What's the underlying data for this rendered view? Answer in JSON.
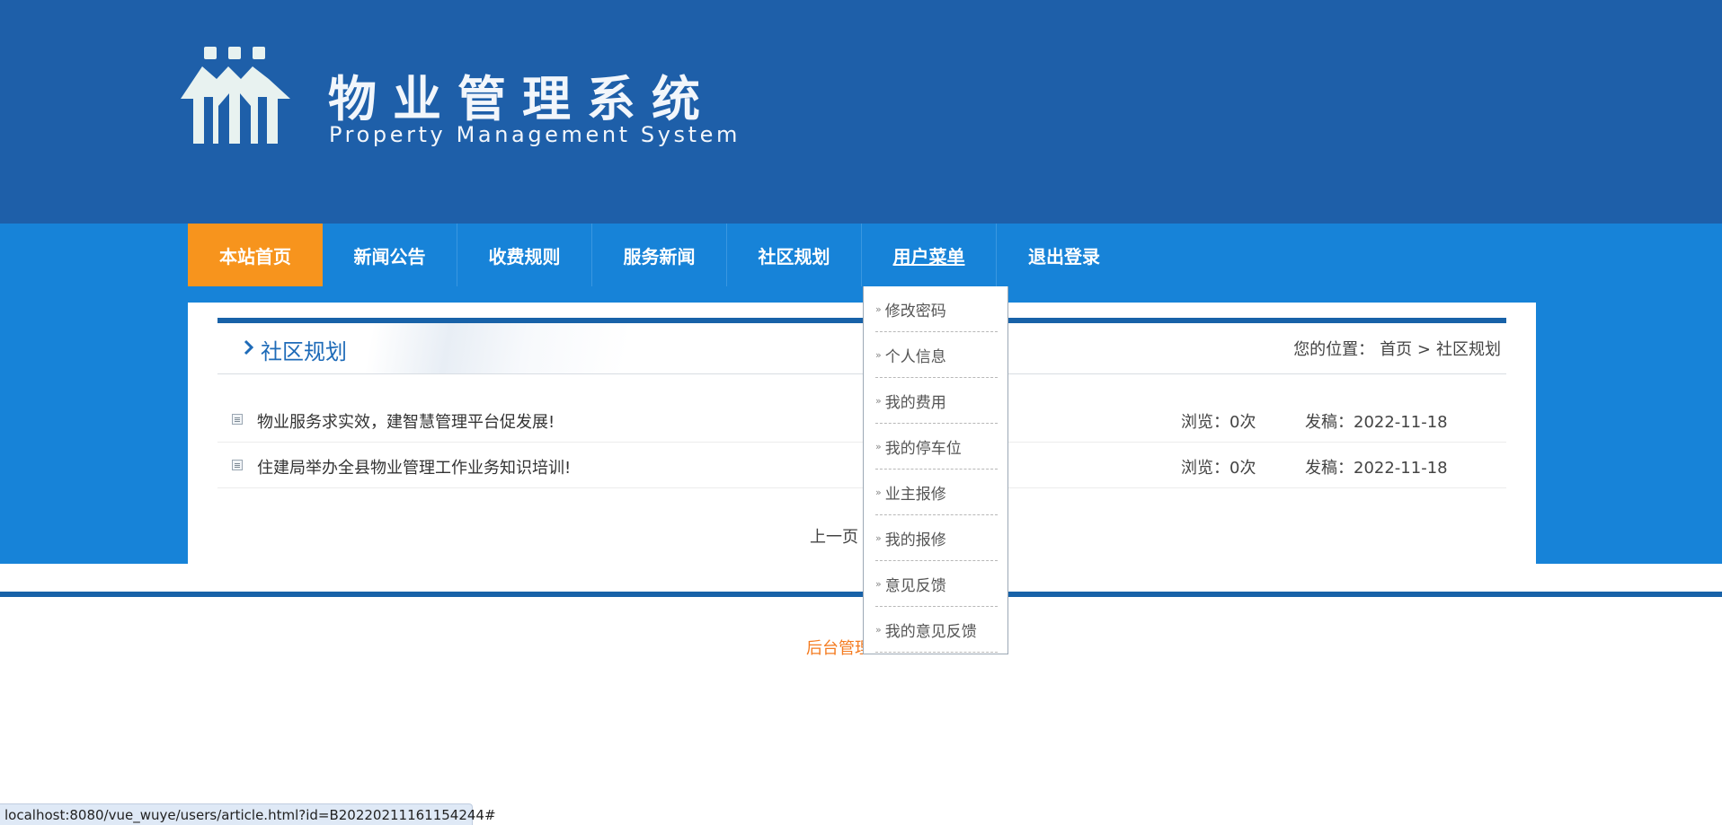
{
  "header": {
    "title": "物业管理系统",
    "subtitle": "Property Management System",
    "logo_icon": "house-people-icon"
  },
  "colors": {
    "header_bg": "#1e5fa9",
    "nav_bg": "#1783d8",
    "nav_active": "#f7941d",
    "accent_line": "#1862a8",
    "footer_link": "#f47b20"
  },
  "nav": {
    "items": [
      {
        "label": "本站首页"
      },
      {
        "label": "新闻公告"
      },
      {
        "label": "收费规则"
      },
      {
        "label": "服务新闻"
      },
      {
        "label": "社区规划"
      },
      {
        "label": "用户菜单"
      },
      {
        "label": "退出登录"
      }
    ],
    "active_index": 0,
    "hover_index": 5
  },
  "user_menu": {
    "items": [
      {
        "label": "修改密码"
      },
      {
        "label": "个人信息"
      },
      {
        "label": "我的费用"
      },
      {
        "label": "我的停车位"
      },
      {
        "label": "业主报修"
      },
      {
        "label": "我的报修"
      },
      {
        "label": "意见反馈"
      },
      {
        "label": "我的意见反馈"
      }
    ]
  },
  "section": {
    "title": "社区规划",
    "breadcrumb_prefix": "您的位置：",
    "breadcrumb_home": "首页 >",
    "breadcrumb_current": "社区规划"
  },
  "articles": [
    {
      "title": "物业服务求实效，建智慧管理平台促发展!",
      "views": "浏览：0次",
      "date": "发稿：2022-11-18"
    },
    {
      "title": "住建局举办全县物业管理工作业务知识培训!",
      "views": "浏览：0次",
      "date": "发稿：2022-11-18"
    }
  ],
  "pager": {
    "prev_label": "上一页"
  },
  "footer": {
    "admin_link": "后台管理"
  },
  "status_bar": {
    "url": "localhost:8080/vue_wuye/users/article.html?id=B20220211161154244#"
  }
}
